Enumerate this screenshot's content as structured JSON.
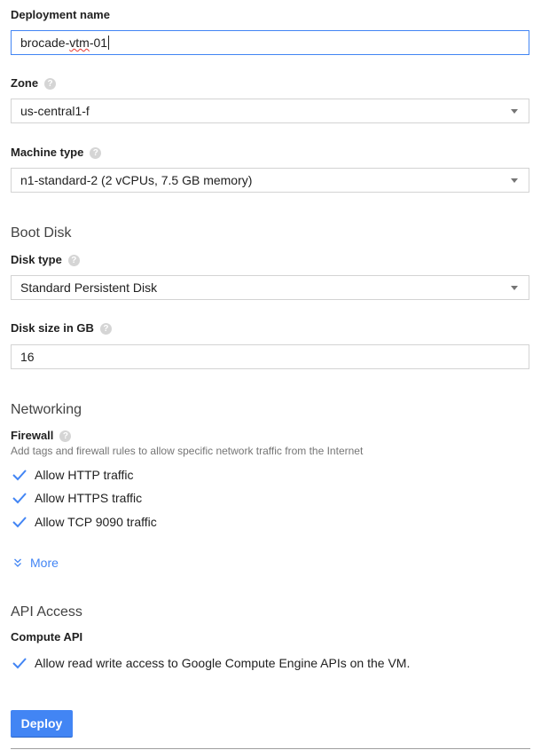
{
  "deployment_name": {
    "label": "Deployment name",
    "value_prefix": "brocade-",
    "value_misspelled": "vtm",
    "value_suffix": "-01"
  },
  "zone": {
    "label": "Zone",
    "value": "us-central1-f"
  },
  "machine_type": {
    "label": "Machine type",
    "value": "n1-standard-2 (2 vCPUs, 7.5 GB memory)"
  },
  "boot_disk": {
    "title": "Boot Disk",
    "disk_type": {
      "label": "Disk type",
      "value": "Standard Persistent Disk"
    },
    "disk_size": {
      "label": "Disk size in GB",
      "value": "16"
    }
  },
  "networking": {
    "title": "Networking",
    "firewall_label": "Firewall",
    "firewall_hint": "Add tags and firewall rules to allow specific network traffic from the Internet",
    "options": [
      {
        "label": "Allow HTTP traffic",
        "checked": true
      },
      {
        "label": "Allow HTTPS traffic",
        "checked": true
      },
      {
        "label": "Allow TCP 9090 traffic",
        "checked": true
      }
    ],
    "more_label": "More"
  },
  "api_access": {
    "title": "API Access",
    "compute_api_label": "Compute API",
    "option": {
      "label": "Allow read write access to Google Compute Engine APIs on the VM.",
      "checked": true
    }
  },
  "help_icon_glyph": "?",
  "deploy_label": "Deploy",
  "colors": {
    "accent": "#4285f4",
    "border": "#d3d3d3",
    "text": "#212121",
    "hint": "#757575"
  }
}
